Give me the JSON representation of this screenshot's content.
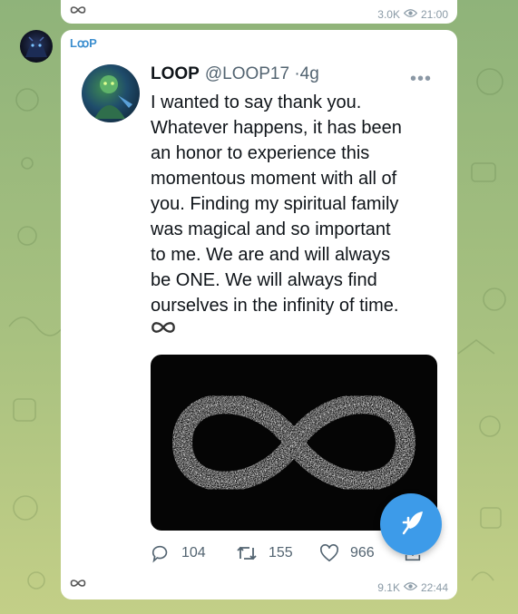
{
  "previous_post": {
    "views": "3.0K",
    "time": "21:00"
  },
  "post": {
    "channel_name": "LꝏP",
    "tweet": {
      "author_name": "LOOP",
      "author_handle": "@LOOP17",
      "separator": "·",
      "age": "4g",
      "text_lines": [
        "I wanted to say thank you.",
        "Whatever happens, it has been",
        "an honor to experience this",
        "momentous moment with all of",
        "you. Finding my spiritual family",
        "was magical and so important",
        "to me. We are and will always",
        "be ONE.  We will always find",
        "ourselves in the infinity of time."
      ],
      "replies": "104",
      "retweets": "155",
      "likes": "966"
    },
    "views": "9.1K",
    "time": "22:44"
  },
  "icons": {
    "infinity": "infinity-icon",
    "views": "eye-icon",
    "more": "more-horizontal-icon",
    "reply": "reply-icon",
    "retweet": "retweet-icon",
    "like": "heart-icon",
    "share": "share-icon",
    "compose": "feather-pen-icon"
  },
  "colors": {
    "accent": "#3d9be9",
    "channel_name": "#3d8fcf",
    "meta_text": "#8a9aa6"
  }
}
